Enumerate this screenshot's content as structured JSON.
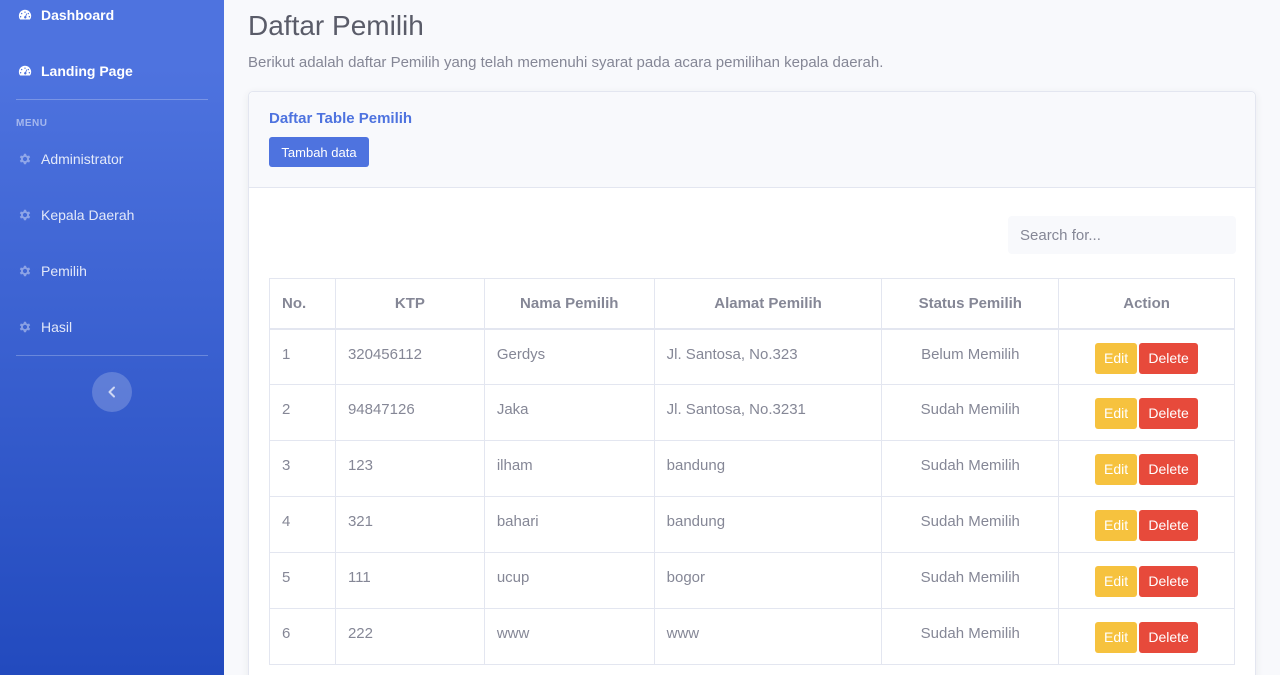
{
  "sidebar": {
    "items": [
      {
        "label": "Dashboard",
        "icon": "dashboard-icon"
      },
      {
        "label": "Landing Page",
        "icon": "dashboard-icon"
      },
      {
        "label": "Administrator",
        "icon": "gear-icon"
      },
      {
        "label": "Kepala Daerah",
        "icon": "gear-icon"
      },
      {
        "label": "Pemilih",
        "icon": "gear-icon"
      },
      {
        "label": "Hasil",
        "icon": "gear-icon"
      }
    ],
    "heading": "MENU",
    "toggle_icon": "chevron-left-icon"
  },
  "page": {
    "title": "Daftar Pemilih",
    "description": "Berikut adalah daftar Pemilih yang telah memenuhi syarat pada acara pemilihan kepala daerah."
  },
  "card": {
    "title": "Daftar Table Pemilih",
    "add_button": "Tambah data",
    "search_placeholder": "Search for..."
  },
  "table": {
    "headers": [
      "No.",
      "KTP",
      "Nama Pemilih",
      "Alamat Pemilih",
      "Status Pemilih",
      "Action"
    ],
    "rows": [
      {
        "no": "1",
        "ktp": "320456112",
        "nama": "Gerdys",
        "alamat": "Jl. Santosa, No.323",
        "status": "Belum Memilih"
      },
      {
        "no": "2",
        "ktp": "94847126",
        "nama": "Jaka",
        "alamat": "Jl. Santosa, No.3231",
        "status": "Sudah Memilih"
      },
      {
        "no": "3",
        "ktp": "123",
        "nama": "ilham",
        "alamat": "bandung",
        "status": "Sudah Memilih"
      },
      {
        "no": "4",
        "ktp": "321",
        "nama": "bahari",
        "alamat": "bandung",
        "status": "Sudah Memilih"
      },
      {
        "no": "5",
        "ktp": "111",
        "nama": "ucup",
        "alamat": "bogor",
        "status": "Sudah Memilih"
      },
      {
        "no": "6",
        "ktp": "222",
        "nama": "www",
        "alamat": "www",
        "status": "Sudah Memilih"
      }
    ],
    "edit_label": "Edit",
    "delete_label": "Delete"
  },
  "colors": {
    "primary": "#4e73df",
    "warning": "#f6c23e",
    "danger": "#e74a3b",
    "text": "#858796"
  }
}
